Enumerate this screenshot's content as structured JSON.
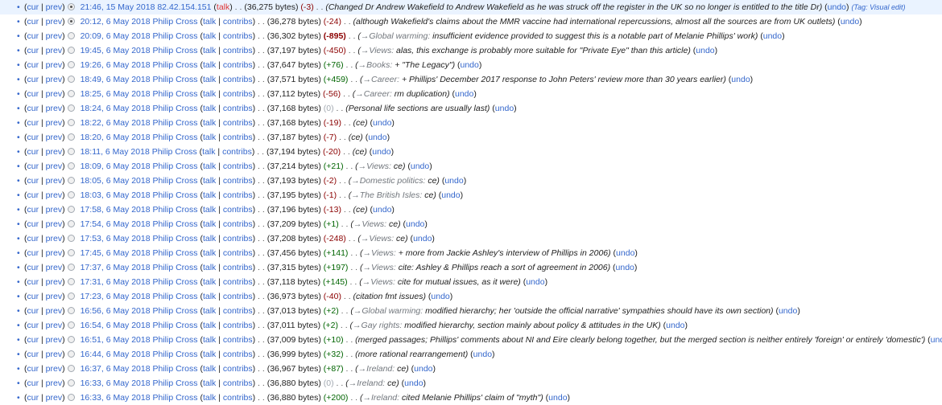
{
  "labels": {
    "cur": "cur",
    "prev": "prev",
    "talk": "talk",
    "contribs": "contribs",
    "undo": "undo",
    "tag_prefix": "Tag:",
    "bytes_suffix": " bytes",
    "arrow": "→"
  },
  "rows": [
    {
      "date": "21:46, 15 May 2018",
      "user": "82.42.154.151",
      "ip": true,
      "size": "36,275",
      "diff": "-3",
      "sign": "neg",
      "section": "",
      "comment": "Changed Dr Andrew Wakefield to Andrew Wakefield as he was struck off the register in the UK so no longer is entitled to the title Dr",
      "tag": "Visual edit",
      "radio": "checked-left"
    },
    {
      "date": "20:12, 6 May 2018",
      "user": "Philip Cross",
      "ip": false,
      "size": "36,278",
      "diff": "-24",
      "sign": "neg",
      "section": "",
      "comment": "although Wakefield's claims about the MMR vaccine had international repercussions, almost all the sources are from UK outlets",
      "tag": "",
      "radio": "checked-right"
    },
    {
      "date": "20:09, 6 May 2018",
      "user": "Philip Cross",
      "ip": false,
      "size": "36,302",
      "diff": "-895",
      "sign": "neg",
      "bold": true,
      "section": "Global warming",
      "comment": "insufficient evidence provided to suggest this is a notable part of Melanie Phillips' work",
      "tag": "",
      "radio": "empty"
    },
    {
      "date": "19:45, 6 May 2018",
      "user": "Philip Cross",
      "ip": false,
      "size": "37,197",
      "diff": "-450",
      "sign": "neg",
      "section": "Views",
      "comment": "alas, this exchange is probably more suitable for \"Private Eye\" than this article",
      "tag": "",
      "radio": "empty"
    },
    {
      "date": "19:26, 6 May 2018",
      "user": "Philip Cross",
      "ip": false,
      "size": "37,647",
      "diff": "+76",
      "sign": "pos",
      "section": "Books",
      "comment": "+ \"The Legacy\"",
      "tag": "",
      "radio": "empty"
    },
    {
      "date": "18:49, 6 May 2018",
      "user": "Philip Cross",
      "ip": false,
      "size": "37,571",
      "diff": "+459",
      "sign": "pos",
      "section": "Career",
      "comment": "+ Phillips' December 2017 response to John Peters' review more than 30 years earlier",
      "tag": "",
      "radio": "empty"
    },
    {
      "date": "18:25, 6 May 2018",
      "user": "Philip Cross",
      "ip": false,
      "size": "37,112",
      "diff": "-56",
      "sign": "neg",
      "section": "Career",
      "comment": "rm duplication",
      "tag": "",
      "radio": "empty"
    },
    {
      "date": "18:24, 6 May 2018",
      "user": "Philip Cross",
      "ip": false,
      "size": "37,168",
      "diff": "0",
      "sign": "zero",
      "section": "",
      "comment": "Personal life sections are usually last",
      "tag": "",
      "radio": "empty"
    },
    {
      "date": "18:22, 6 May 2018",
      "user": "Philip Cross",
      "ip": false,
      "size": "37,168",
      "diff": "-19",
      "sign": "neg",
      "section": "",
      "comment": "ce",
      "tag": "",
      "radio": "empty"
    },
    {
      "date": "18:20, 6 May 2018",
      "user": "Philip Cross",
      "ip": false,
      "size": "37,187",
      "diff": "-7",
      "sign": "neg",
      "section": "",
      "comment": "ce",
      "tag": "",
      "radio": "empty"
    },
    {
      "date": "18:11, 6 May 2018",
      "user": "Philip Cross",
      "ip": false,
      "size": "37,194",
      "diff": "-20",
      "sign": "neg",
      "section": "",
      "comment": "ce",
      "tag": "",
      "radio": "empty"
    },
    {
      "date": "18:09, 6 May 2018",
      "user": "Philip Cross",
      "ip": false,
      "size": "37,214",
      "diff": "+21",
      "sign": "pos",
      "section": "Views",
      "comment": "ce",
      "tag": "",
      "radio": "empty"
    },
    {
      "date": "18:05, 6 May 2018",
      "user": "Philip Cross",
      "ip": false,
      "size": "37,193",
      "diff": "-2",
      "sign": "neg",
      "section": "Domestic politics",
      "comment": "ce",
      "tag": "",
      "radio": "empty"
    },
    {
      "date": "18:03, 6 May 2018",
      "user": "Philip Cross",
      "ip": false,
      "size": "37,195",
      "diff": "-1",
      "sign": "neg",
      "section": "The British Isles",
      "comment": "ce",
      "tag": "",
      "radio": "empty"
    },
    {
      "date": "17:58, 6 May 2018",
      "user": "Philip Cross",
      "ip": false,
      "size": "37,196",
      "diff": "-13",
      "sign": "neg",
      "section": "",
      "comment": "ce",
      "tag": "",
      "radio": "empty"
    },
    {
      "date": "17:54, 6 May 2018",
      "user": "Philip Cross",
      "ip": false,
      "size": "37,209",
      "diff": "+1",
      "sign": "pos",
      "section": "Views",
      "comment": "ce",
      "tag": "",
      "radio": "empty"
    },
    {
      "date": "17:53, 6 May 2018",
      "user": "Philip Cross",
      "ip": false,
      "size": "37,208",
      "diff": "-248",
      "sign": "neg",
      "section": "Views",
      "comment": "ce",
      "tag": "",
      "radio": "empty"
    },
    {
      "date": "17:45, 6 May 2018",
      "user": "Philip Cross",
      "ip": false,
      "size": "37,456",
      "diff": "+141",
      "sign": "pos",
      "section": "Views",
      "comment": "+ more from Jackie Ashley's interview of Phillips in 2006",
      "tag": "",
      "radio": "empty"
    },
    {
      "date": "17:37, 6 May 2018",
      "user": "Philip Cross",
      "ip": false,
      "size": "37,315",
      "diff": "+197",
      "sign": "pos",
      "section": "Views",
      "comment": "cite: Ashley & Phillips reach a sort of agreement in 2006",
      "tag": "",
      "radio": "empty"
    },
    {
      "date": "17:31, 6 May 2018",
      "user": "Philip Cross",
      "ip": false,
      "size": "37,118",
      "diff": "+145",
      "sign": "pos",
      "section": "Views",
      "comment": "cite for mutual issues, as it were",
      "tag": "",
      "radio": "empty"
    },
    {
      "date": "17:23, 6 May 2018",
      "user": "Philip Cross",
      "ip": false,
      "size": "36,973",
      "diff": "-40",
      "sign": "neg",
      "section": "",
      "comment": "citation fmt issues",
      "tag": "",
      "radio": "empty"
    },
    {
      "date": "16:56, 6 May 2018",
      "user": "Philip Cross",
      "ip": false,
      "size": "37,013",
      "diff": "+2",
      "sign": "pos",
      "section": "Global warming",
      "comment": "modified hierarchy; her 'outside the official narrative' sympathies should have its own section",
      "tag": "",
      "radio": "empty"
    },
    {
      "date": "16:54, 6 May 2018",
      "user": "Philip Cross",
      "ip": false,
      "size": "37,011",
      "diff": "+2",
      "sign": "pos",
      "section": "Gay rights",
      "comment": "modified hierarchy, section mainly about policy & attitudes in the UK",
      "tag": "",
      "radio": "empty"
    },
    {
      "date": "16:51, 6 May 2018",
      "user": "Philip Cross",
      "ip": false,
      "size": "37,009",
      "diff": "+10",
      "sign": "pos",
      "section": "",
      "comment": "merged passages; Phillips' comments about NI and Eire clearly belong together, but the merged section is neither entirely 'foreign' or entirely 'domestic'",
      "tag": "",
      "radio": "empty"
    },
    {
      "date": "16:44, 6 May 2018",
      "user": "Philip Cross",
      "ip": false,
      "size": "36,999",
      "diff": "+32",
      "sign": "pos",
      "section": "",
      "comment": "more rational rearrangement",
      "tag": "",
      "radio": "empty"
    },
    {
      "date": "16:37, 6 May 2018",
      "user": "Philip Cross",
      "ip": false,
      "size": "36,967",
      "diff": "+87",
      "sign": "pos",
      "section": "Ireland",
      "comment": "ce",
      "tag": "",
      "radio": "empty"
    },
    {
      "date": "16:33, 6 May 2018",
      "user": "Philip Cross",
      "ip": false,
      "size": "36,880",
      "diff": "0",
      "sign": "zero",
      "section": "Ireland",
      "comment": "ce",
      "tag": "",
      "radio": "empty"
    },
    {
      "date": "16:33, 6 May 2018",
      "user": "Philip Cross",
      "ip": false,
      "size": "36,880",
      "diff": "+200",
      "sign": "pos",
      "section": "Ireland",
      "comment": "cited Melanie Phillips' claim of \"myth\"",
      "tag": "",
      "radio": "empty"
    }
  ]
}
